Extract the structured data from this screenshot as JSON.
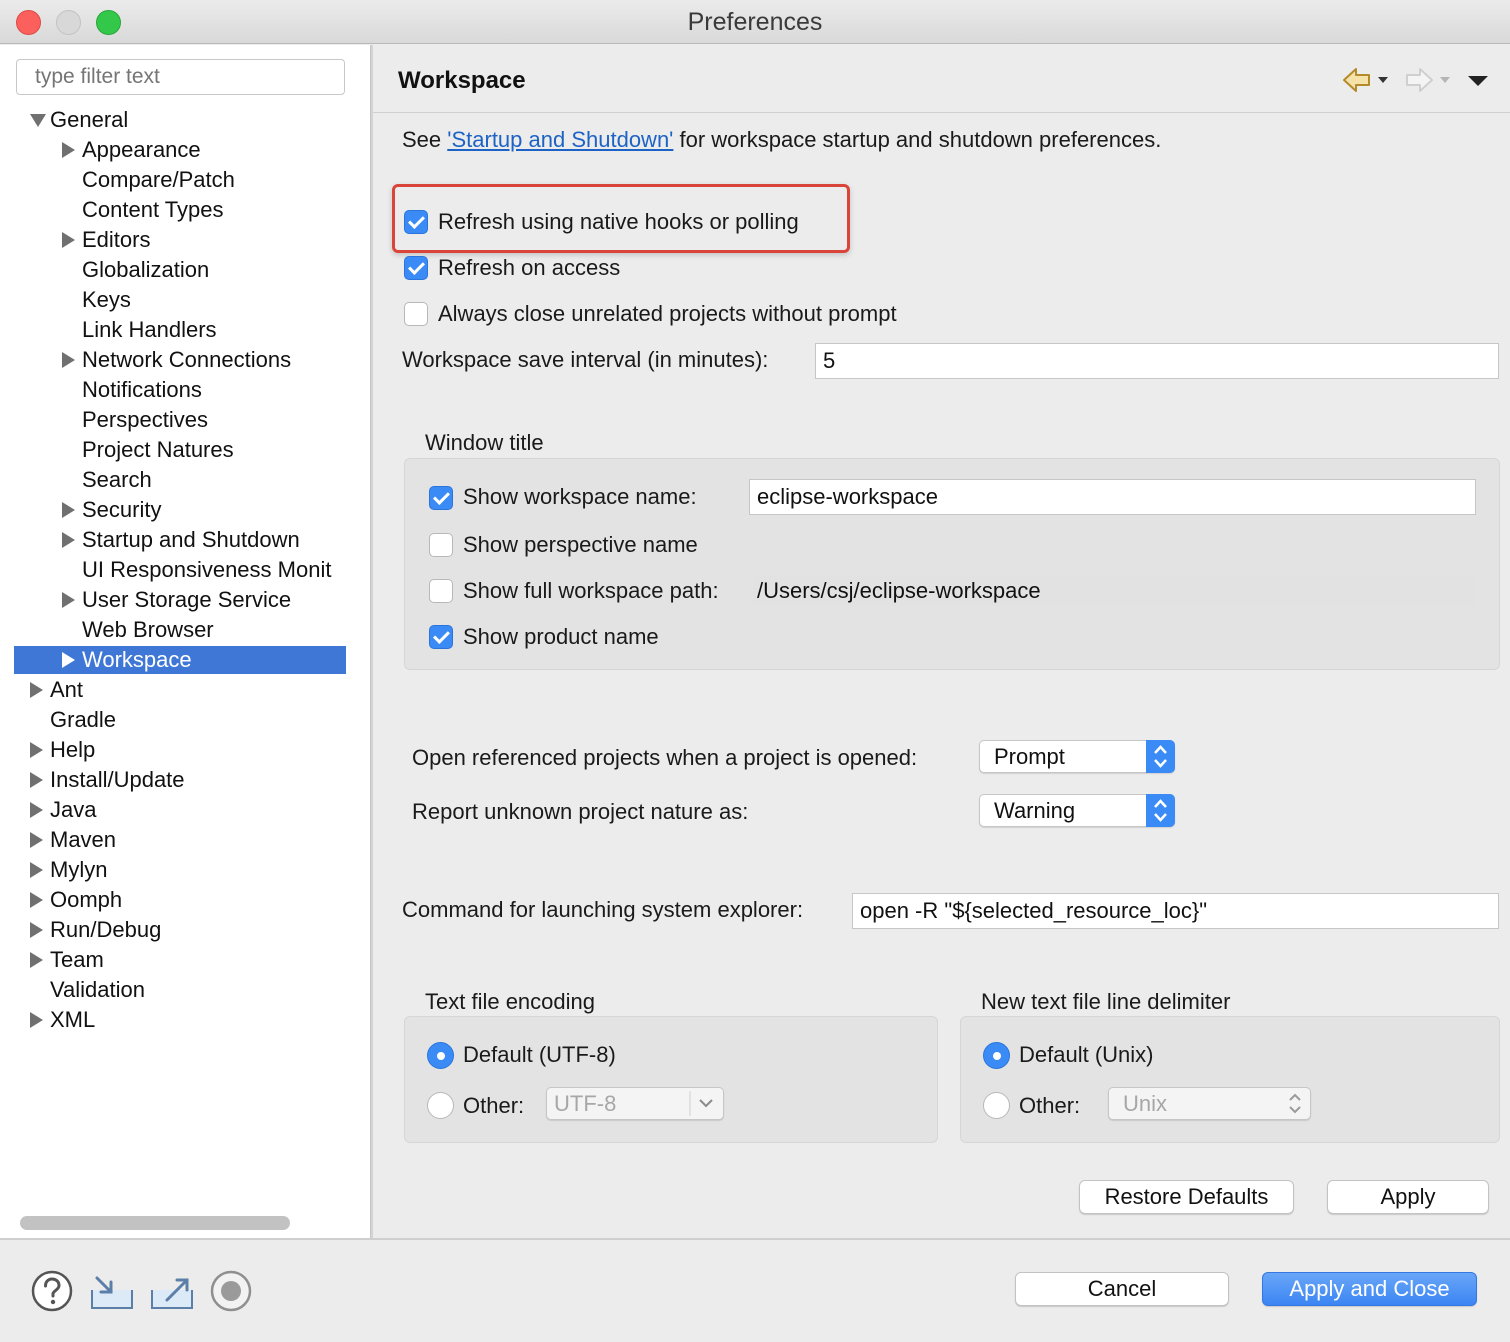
{
  "window": {
    "title": "Preferences"
  },
  "filter": {
    "placeholder": "type filter text"
  },
  "tree": {
    "items": [
      {
        "label": "General",
        "expanded": true,
        "has_children": true,
        "level": 0
      },
      {
        "label": "Appearance",
        "has_children": true,
        "level": 1
      },
      {
        "label": "Compare/Patch",
        "has_children": false,
        "level": 1
      },
      {
        "label": "Content Types",
        "has_children": false,
        "level": 1
      },
      {
        "label": "Editors",
        "has_children": true,
        "level": 1
      },
      {
        "label": "Globalization",
        "has_children": false,
        "level": 1
      },
      {
        "label": "Keys",
        "has_children": false,
        "level": 1
      },
      {
        "label": "Link Handlers",
        "has_children": false,
        "level": 1
      },
      {
        "label": "Network Connections",
        "has_children": true,
        "level": 1
      },
      {
        "label": "Notifications",
        "has_children": false,
        "level": 1
      },
      {
        "label": "Perspectives",
        "has_children": false,
        "level": 1
      },
      {
        "label": "Project Natures",
        "has_children": false,
        "level": 1
      },
      {
        "label": "Search",
        "has_children": false,
        "level": 1
      },
      {
        "label": "Security",
        "has_children": true,
        "level": 1
      },
      {
        "label": "Startup and Shutdown",
        "has_children": true,
        "level": 1
      },
      {
        "label": "UI Responsiveness Monit",
        "has_children": false,
        "level": 1
      },
      {
        "label": "User Storage Service",
        "has_children": true,
        "level": 1
      },
      {
        "label": "Web Browser",
        "has_children": false,
        "level": 1
      },
      {
        "label": "Workspace",
        "has_children": true,
        "level": 1,
        "selected": true
      },
      {
        "label": "Ant",
        "has_children": true,
        "level": 0
      },
      {
        "label": "Gradle",
        "has_children": false,
        "level": 0
      },
      {
        "label": "Help",
        "has_children": true,
        "level": 0
      },
      {
        "label": "Install/Update",
        "has_children": true,
        "level": 0
      },
      {
        "label": "Java",
        "has_children": true,
        "level": 0
      },
      {
        "label": "Maven",
        "has_children": true,
        "level": 0
      },
      {
        "label": "Mylyn",
        "has_children": true,
        "level": 0
      },
      {
        "label": "Oomph",
        "has_children": true,
        "level": 0
      },
      {
        "label": "Run/Debug",
        "has_children": true,
        "level": 0
      },
      {
        "label": "Team",
        "has_children": true,
        "level": 0
      },
      {
        "label": "Validation",
        "has_children": false,
        "level": 0
      },
      {
        "label": "XML",
        "has_children": true,
        "level": 0
      }
    ]
  },
  "page": {
    "title": "Workspace",
    "intro_prefix": "See ",
    "intro_link": "'Startup and Shutdown'",
    "intro_suffix": " for workspace startup and shutdown preferences.",
    "refresh_native": {
      "label": "Refresh using native hooks or polling",
      "checked": true
    },
    "refresh_access": {
      "label": "Refresh on access",
      "checked": true
    },
    "always_close": {
      "label": "Always close unrelated projects without prompt",
      "checked": false
    },
    "save_interval": {
      "label": "Workspace save interval (in minutes):",
      "value": "5"
    },
    "window_title": {
      "group_label": "Window title",
      "show_workspace_name": {
        "label": "Show workspace name:",
        "checked": true,
        "value": "eclipse-workspace"
      },
      "show_perspective_name": {
        "label": "Show perspective name",
        "checked": false
      },
      "show_full_path": {
        "label": "Show full workspace path:",
        "checked": false,
        "value": "/Users/csj/eclipse-workspace"
      },
      "show_product_name": {
        "label": "Show product name",
        "checked": true
      }
    },
    "open_referenced": {
      "label": "Open referenced projects when a project is opened:",
      "value": "Prompt"
    },
    "report_unknown": {
      "label": "Report unknown project nature as:",
      "value": "Warning"
    },
    "system_explorer": {
      "label": "Command for launching system explorer:",
      "value": "open -R \"${selected_resource_loc}\""
    },
    "text_encoding": {
      "group_label": "Text file encoding",
      "default_label": "Default (UTF-8)",
      "other_label": "Other:",
      "other_value": "UTF-8",
      "selected": "default"
    },
    "line_delimiter": {
      "group_label": "New text file line delimiter",
      "default_label": "Default (Unix)",
      "other_label": "Other:",
      "other_value": "Unix",
      "selected": "default"
    },
    "restore_defaults": "Restore Defaults",
    "apply": "Apply"
  },
  "footer": {
    "cancel": "Cancel",
    "apply_close": "Apply and Close",
    "icons": [
      "help-icon",
      "import-icon",
      "export-icon",
      "stop-icon"
    ]
  },
  "colors": {
    "selection": "#3f77d6",
    "checkbox": "#3b8bf6",
    "highlight_box": "#d9453a",
    "link": "#1d63c6"
  }
}
